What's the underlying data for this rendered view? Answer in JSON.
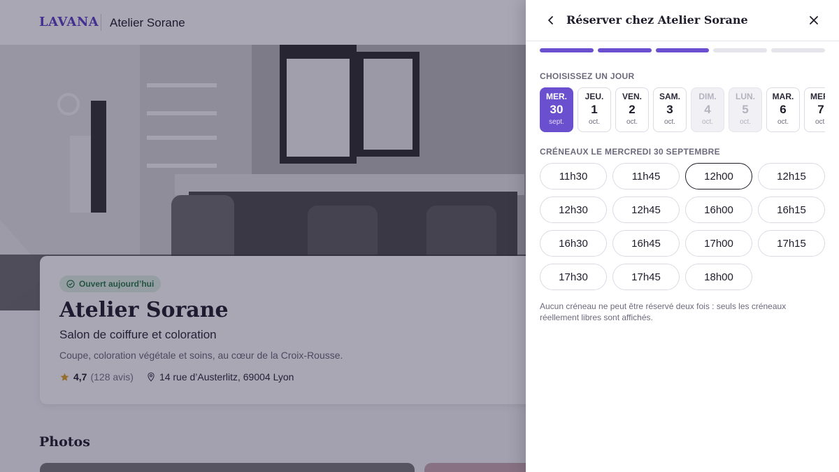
{
  "header": {
    "brand": "LAVANA",
    "salon_name": "Atelier Sorane"
  },
  "salon": {
    "open_badge": "Ouvert aujourd’hui",
    "title": "Atelier Sorane",
    "type": "Salon de coiffure et coloration",
    "description": "Coupe, coloration végétale et soins, au cœur de la Croix-Rousse.",
    "rating": "4,7",
    "reviews": "(128 avis)",
    "address": "14 rue d’Austerlitz, 69004 Lyon"
  },
  "photos": {
    "title": "Photos"
  },
  "panel": {
    "title": "Réserver chez Atelier Sorane",
    "steps_total": 5,
    "steps_done": 3,
    "days_label": "CHOISISSEZ UN JOUR",
    "days": [
      {
        "name": "MER.",
        "date": "30",
        "month": "sept.",
        "state": "selected"
      },
      {
        "name": "JEU.",
        "date": "1",
        "month": "oct.",
        "state": "available"
      },
      {
        "name": "VEN.",
        "date": "2",
        "month": "oct.",
        "state": "available"
      },
      {
        "name": "SAM.",
        "date": "3",
        "month": "oct.",
        "state": "available"
      },
      {
        "name": "DIM.",
        "date": "4",
        "month": "oct.",
        "state": "closed"
      },
      {
        "name": "LUN.",
        "date": "5",
        "month": "oct.",
        "state": "closed"
      },
      {
        "name": "MAR.",
        "date": "6",
        "month": "oct.",
        "state": "available"
      },
      {
        "name": "MER.",
        "date": "7",
        "month": "oct.",
        "state": "available"
      }
    ],
    "slots_label": "CRÉNEAUX LE MERCREDI 30 SEPTEMBRE",
    "slots": [
      "11h30",
      "11h45",
      "12h00",
      "12h15",
      "12h30",
      "12h45",
      "16h00",
      "16h15",
      "16h30",
      "16h45",
      "17h00",
      "17h15",
      "17h30",
      "17h45",
      "18h00"
    ],
    "selected_slot": "12h00",
    "note": "Aucun créneau ne peut être réservé deux fois : seuls les créneaux réellement libres sont affichés."
  },
  "colors": {
    "accent": "#6a4fcf",
    "brand": "#5b3fc4",
    "open_badge_bg": "#dff0e4",
    "open_badge_text": "#2b7a48",
    "star": "#e0a325"
  }
}
